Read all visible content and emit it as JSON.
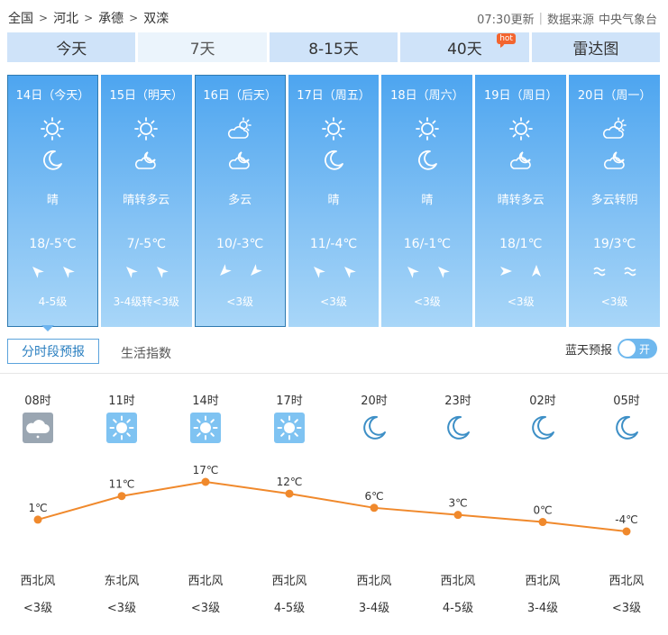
{
  "breadcrumb": {
    "items": [
      "全国",
      "河北",
      "承德",
      "双滦"
    ],
    "separator": ">"
  },
  "meta": {
    "updated": "07:30更新",
    "source_label": "数据来源",
    "source": "中央气象台"
  },
  "tabs": [
    {
      "label": "今天",
      "active": false
    },
    {
      "label": "7天",
      "active": true
    },
    {
      "label": "8-15天",
      "active": false
    },
    {
      "label": "40天",
      "active": false,
      "badge": "hot"
    },
    {
      "label": "雷达图",
      "active": false
    }
  ],
  "days": [
    {
      "date": "14日（今天）",
      "icon_day": "sun-icon",
      "icon_night": "moon-icon",
      "condition": "晴",
      "temp": "18/-5℃",
      "wind_icons": [
        "northeast-arrow-icon",
        "northeast-arrow-icon"
      ],
      "wind_level": "4-5级",
      "highlighted": true
    },
    {
      "date": "15日（明天）",
      "icon_day": "sun-icon",
      "icon_night": "cloud-moon-icon",
      "condition": "晴转多云",
      "temp": "7/-5℃",
      "wind_icons": [
        "northeast-arrow-icon",
        "northeast-arrow-icon"
      ],
      "wind_level": "3-4级转<3级",
      "highlighted": false
    },
    {
      "date": "16日（后天）",
      "icon_day": "cloud-sun-icon",
      "icon_night": "cloud-moon-icon",
      "condition": "多云",
      "temp": "10/-3℃",
      "wind_icons": [
        "southeast-arrow-icon",
        "southeast-arrow-icon"
      ],
      "wind_level": "<3级",
      "highlighted": true
    },
    {
      "date": "17日（周五）",
      "icon_day": "sun-icon",
      "icon_night": "moon-icon",
      "condition": "晴",
      "temp": "11/-4℃",
      "wind_icons": [
        "northeast-arrow-icon",
        "northeast-arrow-icon"
      ],
      "wind_level": "<3级",
      "highlighted": false
    },
    {
      "date": "18日（周六）",
      "icon_day": "sun-icon",
      "icon_night": "moon-icon",
      "condition": "晴",
      "temp": "16/-1℃",
      "wind_icons": [
        "northeast-arrow-icon",
        "northeast-arrow-icon"
      ],
      "wind_level": "<3级",
      "highlighted": false
    },
    {
      "date": "19日（周日）",
      "icon_day": "sun-icon",
      "icon_night": "cloud-moon-icon",
      "condition": "晴转多云",
      "temp": "18/1℃",
      "wind_icons": [
        "east-arrow-icon",
        "north-arrow-icon"
      ],
      "wind_level": "<3级",
      "highlighted": false
    },
    {
      "date": "20日（周一）",
      "icon_day": "cloud-sun-icon",
      "icon_night": "cloud-moon-icon",
      "condition": "多云转阴",
      "temp": "19/3℃",
      "wind_icons": [
        "swirl-wind-icon",
        "swirl-wind-icon"
      ],
      "wind_level": "<3级",
      "highlighted": false
    }
  ],
  "subtabs": {
    "hourly": "分时段预报",
    "indices": "生活指数"
  },
  "bluesky": {
    "label": "蓝天预报",
    "toggle": "开"
  },
  "hourly": [
    {
      "time": "08时",
      "icon": "cloudy-night-icon",
      "temp": "1℃",
      "wind_dir": "西北风",
      "wind_level": "<3级"
    },
    {
      "time": "11时",
      "icon": "sun-icon",
      "temp": "11℃",
      "wind_dir": "东北风",
      "wind_level": "<3级"
    },
    {
      "time": "14时",
      "icon": "sun-icon",
      "temp": "17℃",
      "wind_dir": "西北风",
      "wind_level": "<3级"
    },
    {
      "time": "17时",
      "icon": "sun-icon",
      "temp": "12℃",
      "wind_dir": "西北风",
      "wind_level": "4-5级"
    },
    {
      "time": "20时",
      "icon": "moon-icon",
      "temp": "6℃",
      "wind_dir": "西北风",
      "wind_level": "3-4级"
    },
    {
      "time": "23时",
      "icon": "moon-icon",
      "temp": "3℃",
      "wind_dir": "西北风",
      "wind_level": "4-5级"
    },
    {
      "time": "02时",
      "icon": "moon-icon",
      "temp": "0℃",
      "wind_dir": "西北风",
      "wind_level": "3-4级"
    },
    {
      "time": "05时",
      "icon": "moon-icon",
      "temp": "-4℃",
      "wind_dir": "西北风",
      "wind_level": "<3级"
    }
  ],
  "chart_data": {
    "type": "line",
    "categories": [
      "08时",
      "11时",
      "14时",
      "17时",
      "20时",
      "23时",
      "02时",
      "05时"
    ],
    "values": [
      1,
      11,
      17,
      12,
      6,
      3,
      0,
      -4
    ],
    "labels": [
      "1℃",
      "11℃",
      "17℃",
      "12℃",
      "6℃",
      "3℃",
      "0℃",
      "-4℃"
    ],
    "color": "#f0892c"
  },
  "colors": {
    "accent": "#4da5f0",
    "tab": "#cfe3f9",
    "tab_active": "#ebf4fc",
    "line": "#f0892c",
    "hot": "#f3652f"
  }
}
